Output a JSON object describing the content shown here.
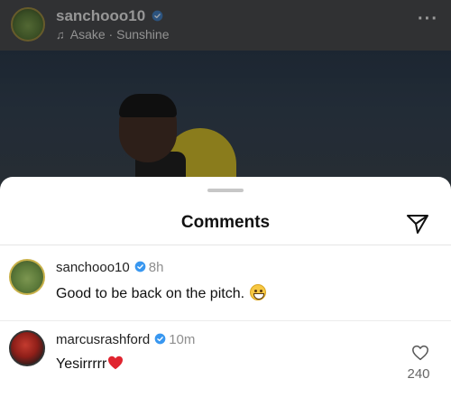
{
  "post": {
    "username": "sanchooo10",
    "music": "Asake · Sunshine",
    "more_label": "···"
  },
  "sheet": {
    "title": "Comments"
  },
  "comments": [
    {
      "username": "sanchooo10",
      "time": "8h",
      "text": "Good to be back on the pitch.",
      "emoji": "grinning-face"
    },
    {
      "username": "marcusrashford",
      "time": "10m",
      "text": "Yesirrrrr",
      "emoji": "red-heart",
      "like_count": "240"
    }
  ],
  "colors": {
    "verified": "#3897f0",
    "heart": "#e0242f"
  }
}
